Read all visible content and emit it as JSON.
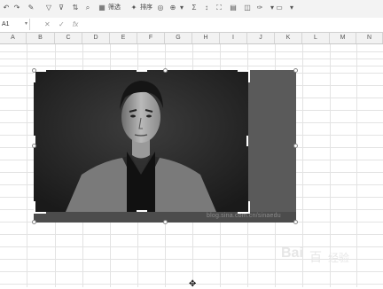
{
  "toolbar": {
    "icons": [
      "undo-icon",
      "redo-icon",
      "format-painter-icon",
      "filter-icon",
      "sort-icon",
      "sort-icon-2",
      "find-icon",
      "chart-icon",
      "table-style-icon",
      "sum-icon",
      "sort-az-icon",
      "freeze-icon",
      "fill-icon",
      "border-icon",
      "color-icon",
      "comment-icon",
      "more-icon"
    ],
    "label_a": "筛选",
    "label_b": "排序"
  },
  "namebox": {
    "value": "A1"
  },
  "formula_bar": {
    "fx_label": "fx",
    "value": ""
  },
  "columns": [
    "A",
    "B",
    "C",
    "D",
    "E",
    "F",
    "G",
    "H",
    "I",
    "J",
    "K",
    "L",
    "M",
    "N"
  ],
  "image": {
    "watermark_url": "blog.sina.com.cn/sinaedu"
  },
  "brand_watermark": {
    "logo": "Bai",
    "logo_paw": "百",
    "text": "经验"
  },
  "colors": {
    "header_bg": "#f2f2f2",
    "grid": "#e3e3e3",
    "image_frame": "#5a5a5a"
  }
}
